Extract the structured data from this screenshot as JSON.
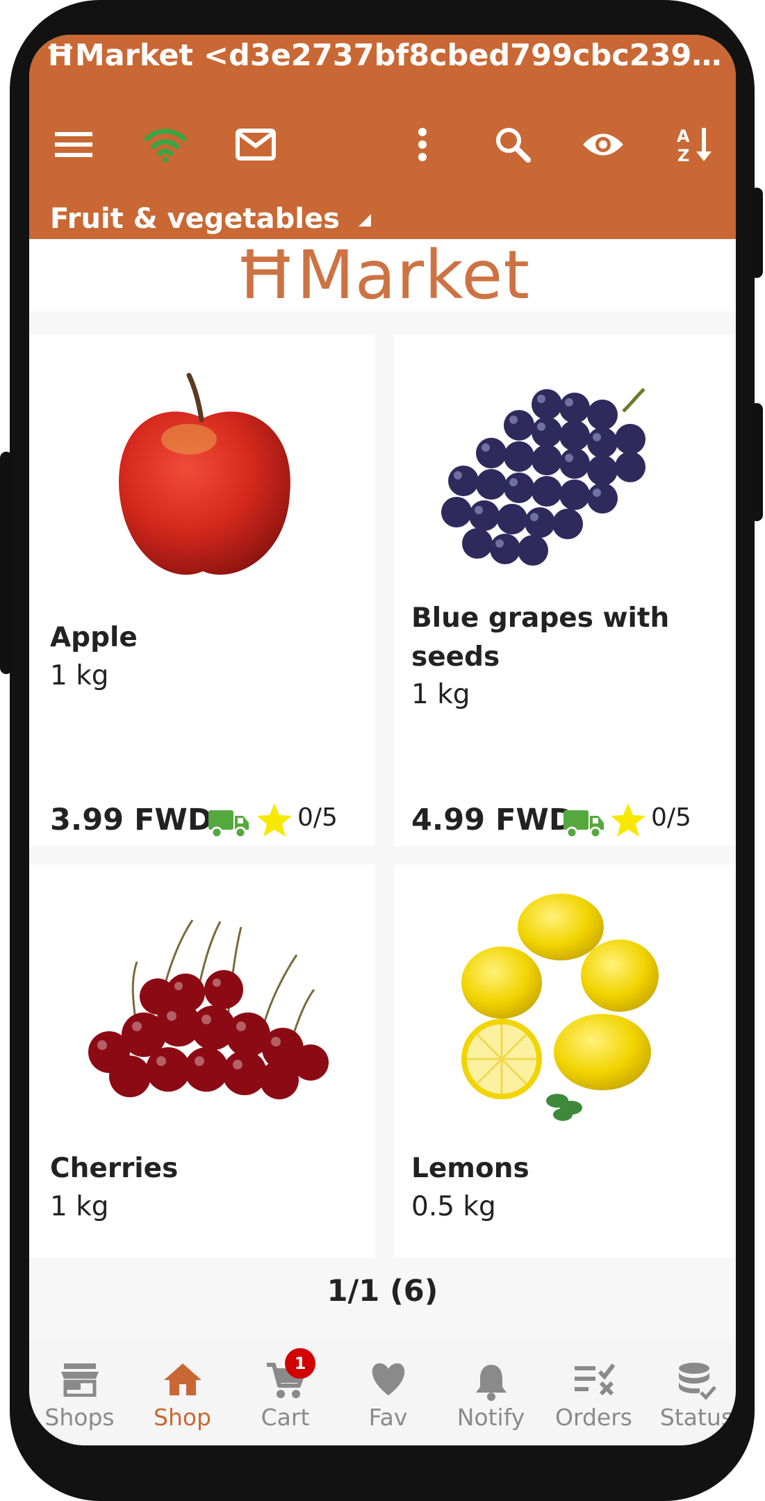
{
  "appbar": {
    "title": "ĦMarket <d3e2737bf8cbed799cbc23903a475...",
    "category": "Fruit & vegetables",
    "icons": [
      "menu-icon",
      "wifi-icon",
      "mail-icon",
      "more-vert-icon",
      "search-icon",
      "eye-icon",
      "sort-az-icon"
    ],
    "wifi_color": "#3aa544",
    "bar_color": "#c96834"
  },
  "banner": {
    "logo_text": "ĦMarket"
  },
  "products": [
    {
      "name": "Apple",
      "qty": "1 kg",
      "price": "3.99 FWD",
      "rating": "0/5",
      "image": "apple"
    },
    {
      "name": "Blue grapes with seeds",
      "qty": "1 kg",
      "price": "4.99 FWD",
      "rating": "0/5",
      "image": "grapes"
    },
    {
      "name": "Cherries",
      "qty": "1 kg",
      "image": "cherries"
    },
    {
      "name": "Lemons",
      "qty": "0.5 kg",
      "image": "lemons"
    }
  ],
  "pager": {
    "text": "1/1 (6)"
  },
  "bottom_nav": {
    "items": [
      {
        "label": "Shops",
        "icon": "store-icon"
      },
      {
        "label": "Shop",
        "icon": "home-icon",
        "active": true
      },
      {
        "label": "Cart",
        "icon": "cart-icon",
        "badge": "1"
      },
      {
        "label": "Fav",
        "icon": "heart-icon"
      },
      {
        "label": "Notify",
        "icon": "bell-icon"
      },
      {
        "label": "Orders",
        "icon": "orders-icon"
      },
      {
        "label": "Status",
        "icon": "database-icon"
      }
    ],
    "active_color": "#c96834",
    "badge_color": "#d20000"
  }
}
